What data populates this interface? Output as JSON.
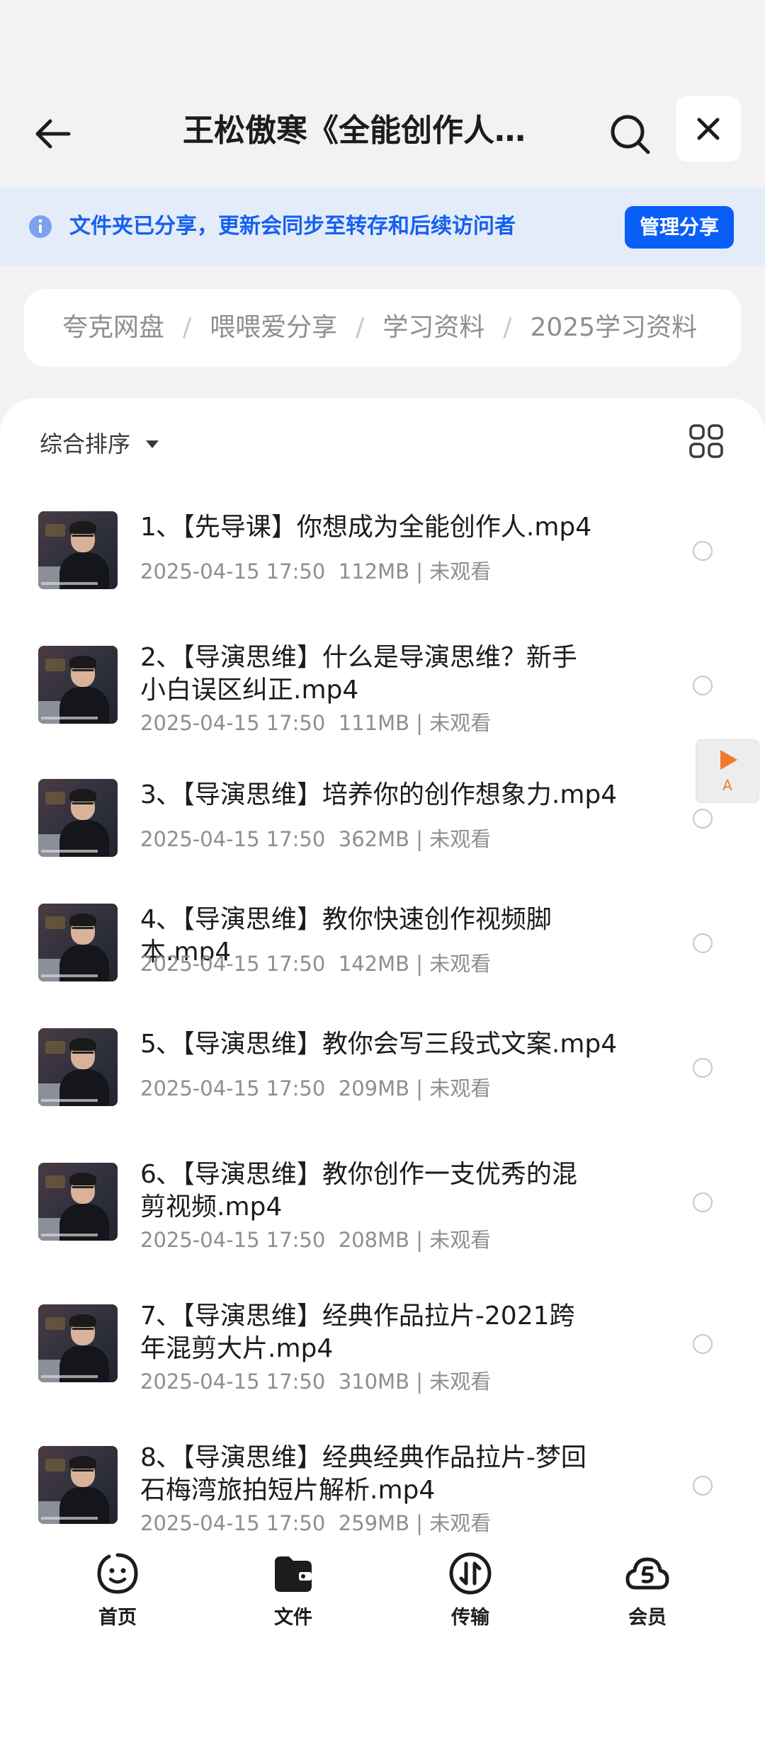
{
  "header": {
    "title": "王松傲寒《全能创作人…"
  },
  "share_notice": {
    "text": "文件夹已分享，更新会同步至转存和后续访问者",
    "button": "管理分享"
  },
  "breadcrumb": [
    "夸克网盘",
    "喂喂爱分享",
    "学习资料",
    "2025学习资料"
  ],
  "sort": {
    "label": "综合排序"
  },
  "files": [
    {
      "name": "1､【先导课】你想成为全能创作人.mp4",
      "date": "2025-04-15 17:50",
      "size": "112MB",
      "status": "未观看"
    },
    {
      "name": "2､【导演思维】什么是导演思维？新手小白误区纠正.mp4",
      "date": "2025-04-15 17:50",
      "size": "111MB",
      "status": "未观看"
    },
    {
      "name": "3､【导演思维】培养你的创作想象力.mp4",
      "date": "2025-04-15 17:50",
      "size": "362MB",
      "status": "未观看"
    },
    {
      "name": "4､【导演思维】教你快速创作视频脚本.mp4",
      "date": "2025-04-15 17:50",
      "size": "142MB",
      "status": "未观看"
    },
    {
      "name": "5､【导演思维】教你会写三段式文案.mp4",
      "date": "2025-04-15 17:50",
      "size": "209MB",
      "status": "未观看"
    },
    {
      "name": "6､【导演思维】教你创作一支优秀的混剪视频.mp4",
      "date": "2025-04-15 17:50",
      "size": "208MB",
      "status": "未观看"
    },
    {
      "name": "7､【导演思维】经典作品拉片-2021跨年混剪大片.mp4",
      "date": "2025-04-15 17:50",
      "size": "310MB",
      "status": "未观看"
    },
    {
      "name": "8､【导演思维】经典经典作品拉片-梦回石梅湾旅拍短片解析.mp4",
      "date": "2025-04-15 17:50",
      "size": "259MB",
      "status": "未观看"
    }
  ],
  "float_button": {
    "letter": "A"
  },
  "tabs": [
    {
      "label": "首页",
      "icon": "smile-face-icon"
    },
    {
      "label": "文件",
      "icon": "folder-icon"
    },
    {
      "label": "传输",
      "icon": "transfer-icon"
    },
    {
      "label": "会员",
      "icon": "cloud-vip-icon"
    }
  ],
  "colors": {
    "accent": "#0a5ef8",
    "notice_bg": "#e4ecfa",
    "notice_text": "#1560f0"
  }
}
